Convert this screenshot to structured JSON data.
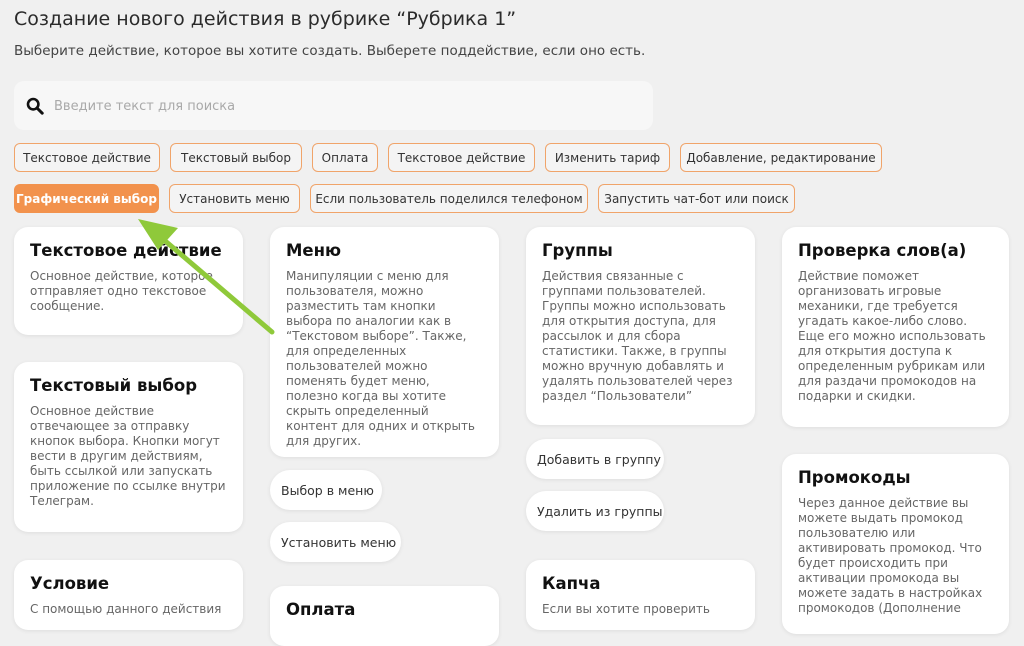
{
  "header": {
    "title": "Создание нового действия в рубрике “Рубрика 1”",
    "subtitle": "Выберите действие, которое вы хотите создать. Выберете поддействие, если оно есть."
  },
  "search": {
    "placeholder": "Введите текст для поиска",
    "value": "",
    "icon": "search-icon"
  },
  "filters": [
    {
      "label": "Текстовое действие",
      "active": false
    },
    {
      "label": "Текстовый выбор",
      "active": false
    },
    {
      "label": "Оплата",
      "active": false
    },
    {
      "label": "Текстовое действие",
      "active": false
    },
    {
      "label": "Изменить тариф",
      "active": false
    },
    {
      "label": "Добавление, редактирование",
      "active": false
    },
    {
      "label": "Графический выбор",
      "active": true
    },
    {
      "label": "Установить меню",
      "active": false
    },
    {
      "label": "Если пользователь поделился телефоном",
      "active": false
    },
    {
      "label": "Запустить чат-бот или поиск",
      "active": false
    }
  ],
  "cards": [
    {
      "title": "Текстовое действие",
      "desc": "Основное действие, которое отправляет одно текстовое сообщение."
    },
    {
      "title": "Текстовый выбор",
      "desc": "Основное действие отвечающее за отправку кнопок выбора. Кнопки могут вести в другим действиям, быть ссылкой или запускать приложение по ссылке внутри Телеграм."
    },
    {
      "title": "Условие",
      "desc": "С помощью данного действия"
    },
    {
      "title": "Меню",
      "desc": "Манипуляции с меню для пользователя, можно разместить там кнопки выбора по аналогии как в “Текстовом выборе”. Также, для определенных пользователей можно поменять будет меню, полезно когда вы хотите скрыть определенный контент для одних и открыть для других."
    },
    {
      "title": "Оплата",
      "desc": ""
    },
    {
      "title": "Группы",
      "desc": "Действия связанные с группами пользователей. Группы можно использовать для открытия доступа, для рассылок и для сбора статистики. Также, в группы можно вручную добавлять и удалять пользователей через раздел “Пользователи”"
    },
    {
      "title": "Капча",
      "desc": "Если вы хотите проверить"
    },
    {
      "title": "Проверка слов(а)",
      "desc": "Действие поможет организовать игровые механики, где требуется угадать какое-либо слово. Еще его можно использовать для открытия доступа к определенным рубрикам или для раздачи промокодов на подарки и скидки."
    },
    {
      "title": "Промокоды",
      "desc": "Через данное действие вы можете выдать промокод пользователю или активировать промокод. Что будет происходить при активации промокода вы можете задать в настройках промокодов (Дополнение"
    }
  ],
  "subactions": [
    {
      "label": "Выбор в меню"
    },
    {
      "label": "Установить меню"
    },
    {
      "label": "Добавить в группу"
    },
    {
      "label": "Удалить из группы"
    }
  ],
  "annotation": {
    "color": "#8fc93a",
    "icon": "arrow-icon"
  }
}
